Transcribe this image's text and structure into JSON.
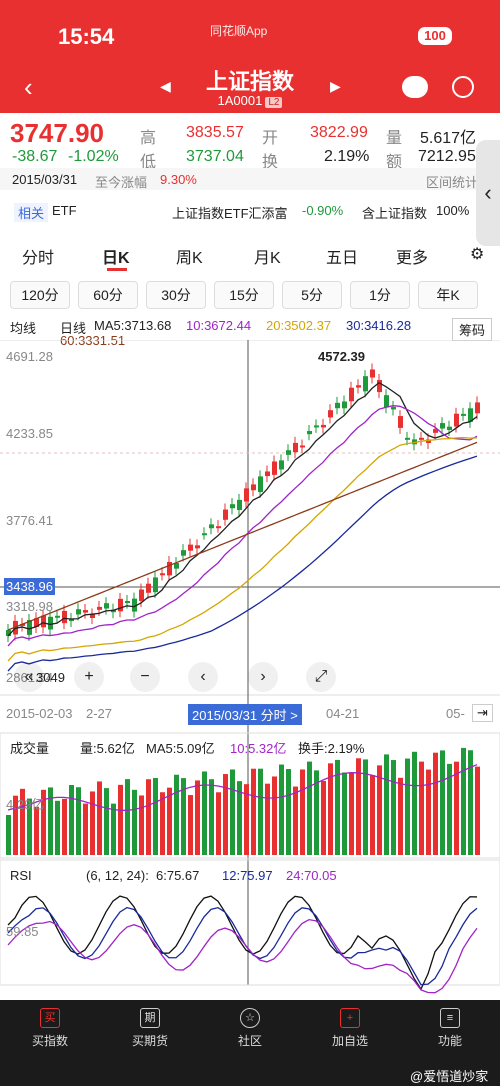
{
  "status_bar": {
    "time": "15:54",
    "app_label": "同花顺App",
    "battery": "100"
  },
  "header": {
    "title": "上证指数",
    "code": "1A0001",
    "level": "L2"
  },
  "quote": {
    "price": "3747.90",
    "change": "-38.67",
    "change_pct": "-1.02%",
    "high_label": "高",
    "high": "3835.57",
    "low_label": "低",
    "low": "3737.04",
    "open_label": "开",
    "open": "3822.99",
    "turnover_label": "换",
    "turnover": "2.19%",
    "volume_label": "量",
    "volume": "5.617亿",
    "amount_label": "额",
    "amount": "7212.95",
    "date": "2015/03/31",
    "since_label": "至今涨幅",
    "since_value": "9.30%",
    "range_stat": "区间统计"
  },
  "related": {
    "tag": "相关",
    "etf": "ETF",
    "etf_name": "上证指数ETF汇添富",
    "etf_change": "-0.90%",
    "hold_label": "含上证指数",
    "hold_value": "100%"
  },
  "tabs": [
    "分时",
    "日K",
    "周K",
    "月K",
    "五日",
    "更多"
  ],
  "periods": [
    "120分",
    "60分",
    "30分",
    "15分",
    "5分",
    "1分",
    "年K"
  ],
  "ma": {
    "label": "均线",
    "kind": "日线",
    "ma5": "MA5:3713.68",
    "ma10": "10:3672.44",
    "ma20": "20:3502.37",
    "ma30": "30:3416.28",
    "ma60": "60:3331.51",
    "chips_button": "筹码"
  },
  "price_axis": [
    "4691.28",
    "4233.85",
    "3776.41",
    "3318.98",
    "2861.54"
  ],
  "cursor_price": "3438.96",
  "annotations": {
    "high_mark": "4572.39",
    "low_mark": "3049"
  },
  "dates": {
    "left": "2015-02-03",
    "mid": "2-27",
    "cursor": "2015/03/31 分时 >",
    "right": "04-21",
    "far": "05-"
  },
  "volume_panel": {
    "label": "成交量",
    "vol": "量:5.62亿",
    "ma5": "MA5:5.09亿",
    "ma10": "10:5.32亿",
    "turn": "换手:2.19%",
    "axis": "4.29亿"
  },
  "rsi_panel": {
    "label": "RSI",
    "params": "(6, 12, 24):",
    "r6": "6:75.67",
    "r12": "12:75.97",
    "r24": "24:70.05",
    "axis": "59.85"
  },
  "bottom_nav": [
    "买指数",
    "买期货",
    "社区",
    "加自选",
    "功能"
  ],
  "watermark": "@爱悟道炒家",
  "colors": {
    "up": "#e93030",
    "down": "#1e9a3a",
    "header": "#e93030"
  }
}
